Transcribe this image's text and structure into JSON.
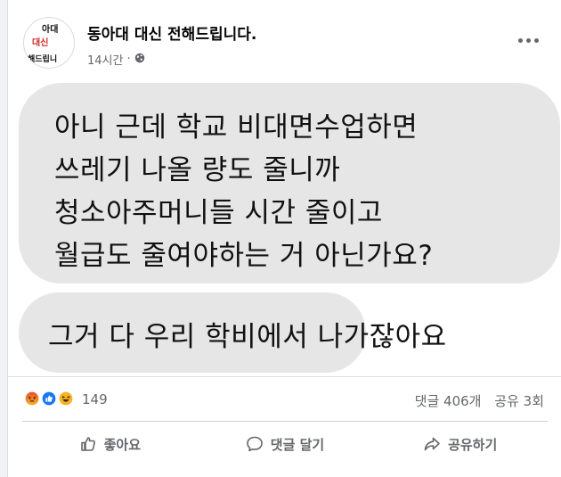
{
  "post": {
    "page_name": "동아대 대신 전해드립니다.",
    "time": "14시간",
    "separator": "·",
    "avatar_text": {
      "line1": "아대",
      "line2": "대신",
      "line3": "해드립니"
    }
  },
  "image_text": {
    "bubble1": [
      "아니 근데 학교 비대면수업하면",
      "쓰레기 나올 량도 줄니까",
      "청소아주머니들 시간 줄이고",
      "월급도 줄여야하는 거 아닌가요?"
    ],
    "bubble2": [
      "그거 다 우리 학비에서 나가잖아요"
    ]
  },
  "engagement": {
    "reaction_count": "149",
    "comments": "댓글 406개",
    "shares": "공유 3회",
    "reaction_icons": [
      "angry-icon",
      "like-icon",
      "haha-icon"
    ]
  },
  "actions": {
    "like": "좋아요",
    "comment": "댓글 달기",
    "share": "공유하기"
  },
  "colors": {
    "page_background": "#f0f2f5",
    "bubble": "#e6e6e6",
    "secondary_text": "#65676b",
    "like_blue": "#1877f2",
    "reaction_orange": "#f7b125",
    "angry_red": "#e9710f"
  }
}
